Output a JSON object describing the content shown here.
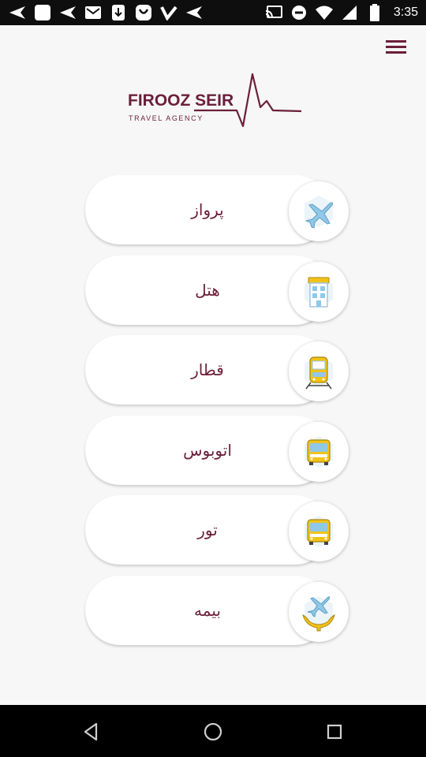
{
  "status_bar": {
    "time": "3:35",
    "left_icons": [
      "send-icon",
      "app-icon",
      "send-icon",
      "gmail-icon",
      "download-icon",
      "app-icon",
      "check-icon",
      "send-icon"
    ],
    "right_icons": [
      "cast-icon",
      "dnd-icon",
      "wifi-icon",
      "signal-icon",
      "battery-icon"
    ]
  },
  "logo": {
    "name": "FIROOZ SEIR",
    "tagline": "TRAVEL AGENCY",
    "color": "#6b1f3a"
  },
  "menu_icon": "hamburger-icon",
  "services": [
    {
      "label": "پرواز",
      "icon": "airplane-icon"
    },
    {
      "label": "هتل",
      "icon": "hotel-icon"
    },
    {
      "label": "قطار",
      "icon": "train-icon"
    },
    {
      "label": "اتوبوس",
      "icon": "bus-icon"
    },
    {
      "label": "تور",
      "icon": "tour-bus-icon"
    },
    {
      "label": "بیمه",
      "icon": "insurance-icon"
    }
  ],
  "nav_bar": {
    "buttons": [
      "back-icon",
      "home-icon",
      "recents-icon"
    ]
  },
  "colors": {
    "brand": "#6b1f3a",
    "icon_blue": "#8fc8e8",
    "icon_yellow": "#f2c21a"
  }
}
